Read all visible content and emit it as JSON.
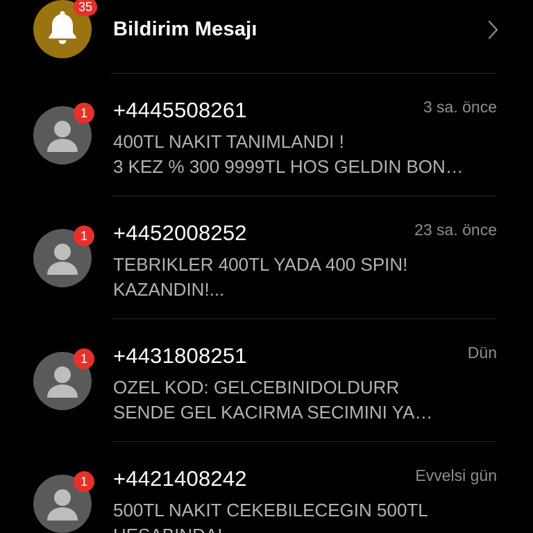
{
  "header": {
    "title": "Bildirim Mesajı",
    "badge_count": "35",
    "icon": "bell-icon",
    "chevron_icon": "chevron-right-icon"
  },
  "messages": [
    {
      "sender": "+4445508261",
      "time": "3 sa. önce",
      "unread": "1",
      "preview_line1": "400TL NAKIT TANIMLANDI !",
      "preview_line2": "3 KEZ % 300 9999TL HOS GELDIN BON…",
      "icon": "person-icon"
    },
    {
      "sender": "+4452008252",
      "time": "23 sa. önce",
      "unread": "1",
      "preview_line1": "TEBRIKLER 400TL YADA 400 SPIN!",
      "preview_line2": "KAZANDIN!...",
      "icon": "person-icon"
    },
    {
      "sender": "+4431808251",
      "time": "Dün",
      "unread": "1",
      "preview_line1": "OZEL KOD: GELCEBINIDOLDURR",
      "preview_line2": "SENDE GEL KACIRMA SECIMINI YA…",
      "icon": "person-icon"
    },
    {
      "sender": "+4421408242",
      "time": "Evvelsi gün",
      "unread": "1",
      "preview_line1": "500TL NAKIT CEKEBILECEGIN 500TL",
      "preview_line2": "HESABINDA!",
      "icon": "person-icon"
    }
  ],
  "colors": {
    "background": "#000000",
    "avatar_gray": "#5a5a5a",
    "bell_gold": "#9a7410",
    "badge_red": "#e8302a",
    "secondary_text": "#8f8f8f",
    "preview_text": "#b3b3b3"
  }
}
